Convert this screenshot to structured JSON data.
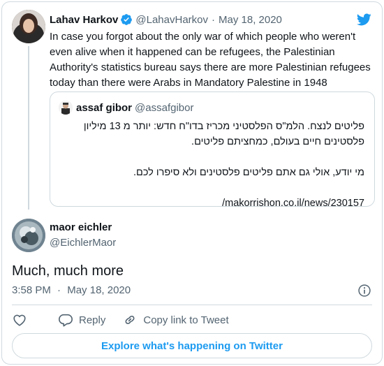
{
  "colors": {
    "accent": "#1d9bf0",
    "text": "#0f1419",
    "muted": "#536471",
    "border": "#cfd9de"
  },
  "parent_tweet": {
    "author_name": "Lahav Harkov",
    "handle": "@LahavHarkov",
    "separator": "·",
    "date": "May 18, 2020",
    "verified_icon": "verified-badge-icon",
    "text": "In case you forgot about the only war of which people who weren't even alive when it happened can be refugees, the Palestinian Authority's statistics bureau says there are more Palestinian refugees today than there were Arabs in Mandatory Palestine in 1948",
    "quoted": {
      "author_name": "assaf gibor",
      "handle": "@assafgibor",
      "lines": [
        "פליטים לנצח. הלמ\"ס הפלסטיני מכריז בדו\"ח חדש: יותר מ 13 מיליון",
        "פלסטינים חיים בעולם, כמחציתם פליטים.",
        "",
        "מי יודע, אולי גם אתם פליטים פלסטינים ולא סיפרו לכם.",
        "",
        "makorrishon.co.il/news/230157/"
      ]
    }
  },
  "main_tweet": {
    "author_name": "maor eichler",
    "handle": "@EichlerMaor",
    "text": "Much, much more",
    "time": "3:58 PM",
    "separator": "·",
    "date": "May 18, 2020"
  },
  "actions": {
    "reply_label": "Reply",
    "copy_link_label": "Copy link to Tweet"
  },
  "explore_label": "Explore what's happening on Twitter"
}
